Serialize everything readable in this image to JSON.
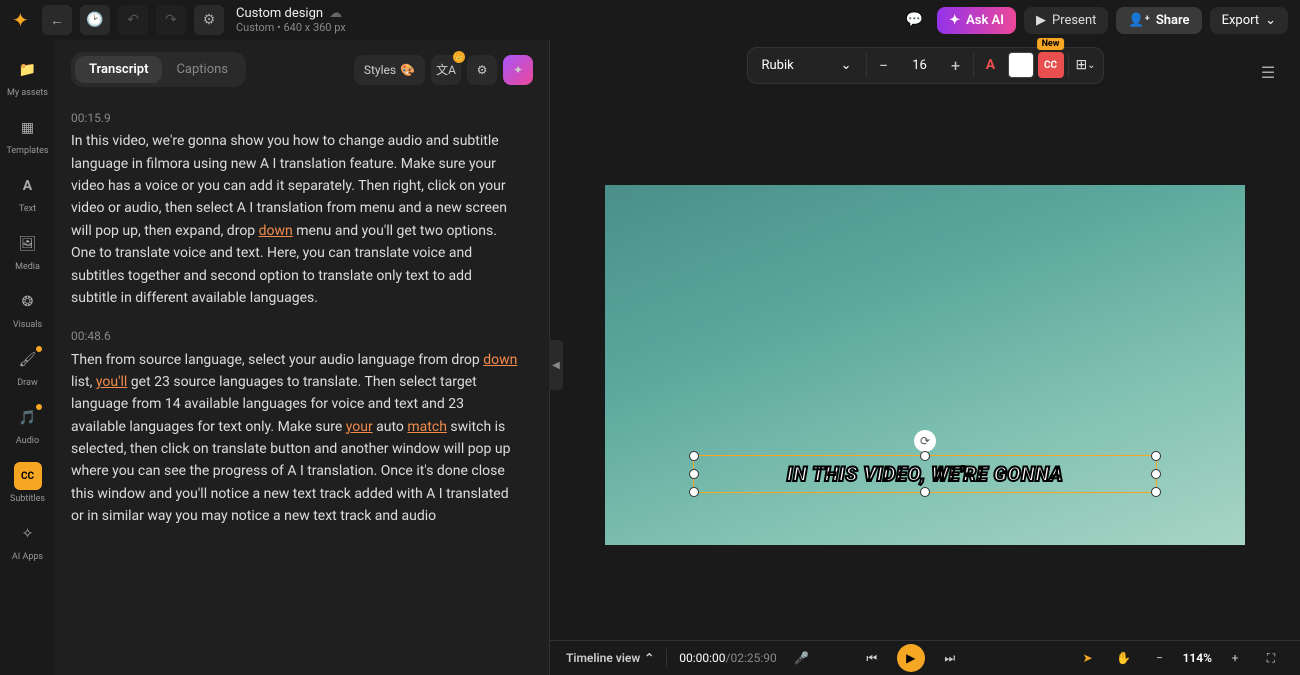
{
  "header": {
    "title": "Custom design",
    "subtitle": "Custom • 640 x 360 px",
    "ask_ai": "Ask AI",
    "present": "Present",
    "share": "Share",
    "export": "Export"
  },
  "sidebar": {
    "items": [
      {
        "label": "My assets"
      },
      {
        "label": "Templates"
      },
      {
        "label": "Text"
      },
      {
        "label": "Media"
      },
      {
        "label": "Visuals"
      },
      {
        "label": "Draw"
      },
      {
        "label": "Audio"
      },
      {
        "label": "Subtitles"
      },
      {
        "label": "AI Apps"
      }
    ]
  },
  "panel": {
    "tabs": {
      "transcript": "Transcript",
      "captions": "Captions"
    },
    "styles_label": "Styles",
    "segments": [
      {
        "time": "00:15.9",
        "parts": [
          {
            "t": "In this video, we're gonna show you how to change audio and subtitle language in filmora using new A I translation feature. Make sure your video has a voice or you can add it separately. Then right, click on your video or audio, then select A I translation from menu and a new screen will pop up, then expand, drop "
          },
          {
            "t": "down",
            "link": true
          },
          {
            "t": " menu and you'll get two options. One to translate voice and text. Here, you can translate voice and subtitles together and second option to translate only text to add subtitle in different available languages."
          }
        ]
      },
      {
        "time": "00:48.6",
        "parts": [
          {
            "t": "Then from source language, select your audio language from drop "
          },
          {
            "t": "down",
            "link": true
          },
          {
            "t": " list, "
          },
          {
            "t": "you'll",
            "link": true
          },
          {
            "t": " get 23 source languages to translate. Then select target language from 14 available languages for voice and text and 23 available languages for text only. Make sure "
          },
          {
            "t": "your",
            "link": true
          },
          {
            "t": " auto "
          },
          {
            "t": "match",
            "link": true
          },
          {
            "t": " switch is selected, then click on translate button and another window will pop up where you can see the progress of A I translation. Once it's done close this window and you'll notice a new text track added with A I translated or in similar way you may notice a new text track and audio"
          }
        ]
      }
    ]
  },
  "canvas": {
    "font": "Rubik",
    "font_size": "16",
    "cc_badge": "New",
    "caption": "IN THIS VIDEO, WE'RE GONNA"
  },
  "bottombar": {
    "timeline_label": "Timeline view",
    "time_current": "00:00:00",
    "time_total": "/02:25:90",
    "zoom": "114%"
  }
}
